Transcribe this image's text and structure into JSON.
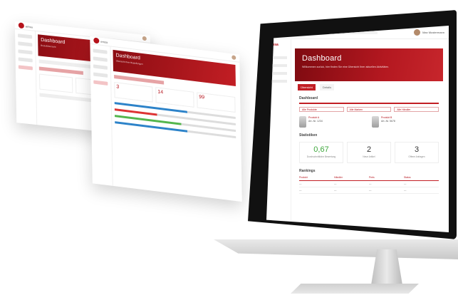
{
  "brand": {
    "name": "emsa",
    "accent": "#c21e24"
  },
  "back_panel": {
    "hero_title": "Dashboard",
    "hero_subtitle": "Bestellübersicht",
    "cards": [
      "",
      "",
      ""
    ]
  },
  "front_panel": {
    "hero_title": "Dashboard",
    "hero_subtitle": "Übersicht Ihrer Bestellungen",
    "stats": [
      "3",
      "14",
      "99"
    ]
  },
  "imac": {
    "user": {
      "name": "Max Mustermann"
    },
    "hero": {
      "title": "Dashboard",
      "subtitle": "Willkommen zurück, hier finden Sie eine Übersicht Ihrer aktuellen Aktivitäten."
    },
    "tabs": [
      "Übersicht",
      "Details"
    ],
    "section_top": "Dashboard",
    "filters": [
      "Alle Produkte",
      "Alle Marken",
      "Alle Händler"
    ],
    "compare": [
      {
        "name": "Produkt A",
        "meta": "Art.-Nr. 1234"
      },
      {
        "name": "Produkt B",
        "meta": "Art.-Nr. 5678"
      }
    ],
    "stats_title": "Statistiken",
    "stats": [
      {
        "value": "0,67",
        "label": "Durchschnittliche Bewertung",
        "color": "#3da73b"
      },
      {
        "value": "2",
        "label": "Neue Artikel",
        "color": "#333333"
      },
      {
        "value": "3",
        "label": "Offene Anfragen",
        "color": "#333333"
      }
    ],
    "table_title": "Rankings",
    "table_headers": [
      "Produkt",
      "Händler",
      "Preis",
      "Status"
    ],
    "table_rows": [
      [
        "—",
        "—",
        "—",
        "—"
      ],
      [
        "—",
        "—",
        "—",
        "—"
      ]
    ]
  }
}
